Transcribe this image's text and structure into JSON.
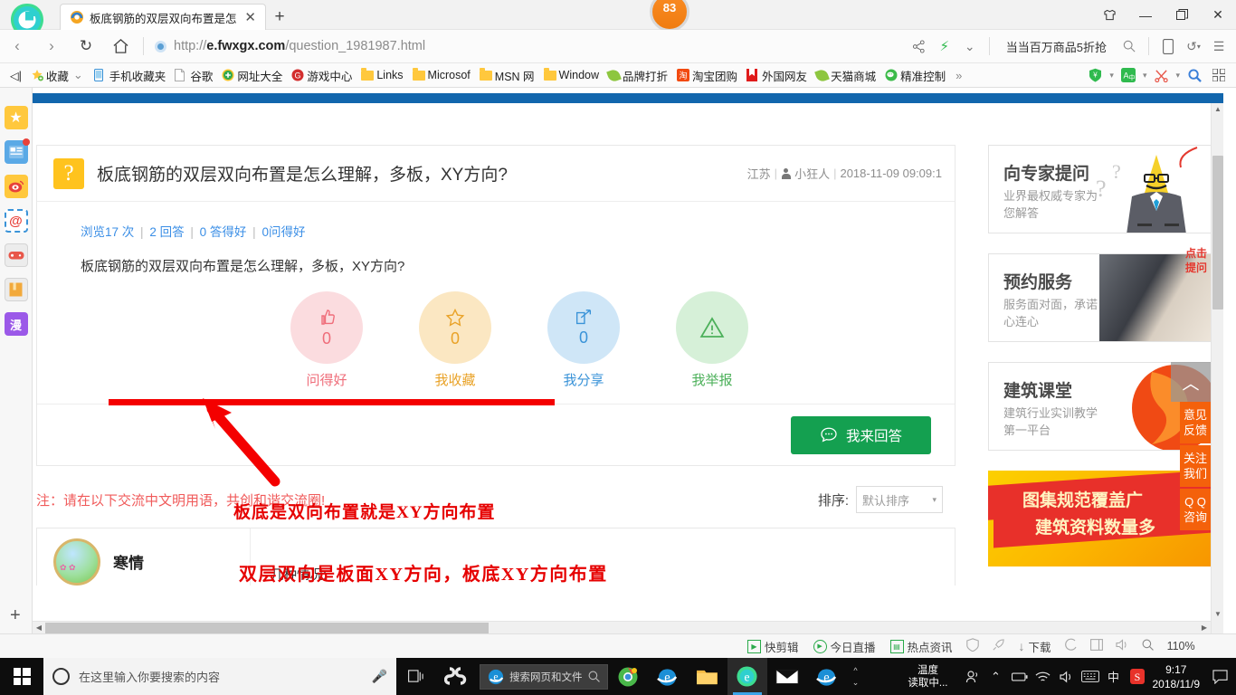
{
  "browser": {
    "tab": {
      "title": "板底钢筋的双层双向布置是怎么理",
      "close": "✕",
      "favicon": "browser-favicon"
    },
    "newtab_label": "+",
    "badge": "83",
    "window_controls": {
      "shirt": "👕",
      "minimize": "—",
      "restore": "❐",
      "close": "✕"
    },
    "nav": {
      "back": "‹",
      "forward": "›",
      "reload": "↻",
      "home": "⌂"
    },
    "url": {
      "scheme": "http://",
      "domain": "e.fwxgx.com",
      "path": "/question_1981987.html"
    },
    "promo": "当当百万商品5折抢",
    "nav_right_icons": [
      "share-icon",
      "lightning-icon",
      "chevron-down-icon",
      "search-icon",
      "mobile-icon",
      "undo-icon",
      "menu-icon"
    ],
    "bookmarks": [
      {
        "label": "收藏",
        "icon": "star-bookmark-icon",
        "has_chevron": true
      },
      {
        "label": "手机收藏夹",
        "icon": "mobile-icon"
      },
      {
        "label": "谷歌",
        "icon": "page-icon"
      },
      {
        "label": "网址大全",
        "icon": "plus-green-icon"
      },
      {
        "label": "游戏中心",
        "icon": "game-red-icon"
      },
      {
        "label": "Links",
        "icon": "folder-icon"
      },
      {
        "label": "Microsof",
        "icon": "folder-icon"
      },
      {
        "label": "MSN 网",
        "icon": "folder-icon"
      },
      {
        "label": "Window",
        "icon": "folder-icon"
      },
      {
        "label": "品牌打折",
        "icon": "leaf-icon"
      },
      {
        "label": "淘宝团购",
        "icon": "taobao-icon"
      },
      {
        "label": "外国网友",
        "icon": "red-flag-icon"
      },
      {
        "label": "天猫商城",
        "icon": "leaf-icon"
      },
      {
        "label": "精准控制",
        "icon": "wechat-icon"
      }
    ],
    "bookmarks_overflow": "»",
    "bookmarks_right_icons": [
      "shield-icon",
      "translate-icon",
      "scissors-icon",
      "magnifier-icon",
      "apps-icon"
    ],
    "back_arrow": "◁|"
  },
  "leftbar": {
    "items": [
      {
        "name": "favorites-star",
        "glyph": "★",
        "bg": "#ffc83d",
        "fg": "#ffffff"
      },
      {
        "name": "news-feed",
        "glyph": "▤",
        "bg": "#5aa9e6",
        "fg": "#ffffff",
        "dot": true
      },
      {
        "name": "weibo",
        "glyph": "◉",
        "bg": "#ffc83d",
        "fg": "#e8413a"
      },
      {
        "name": "email-at",
        "glyph": "@",
        "bg": "#ffffff",
        "fg": "#e8413a"
      },
      {
        "name": "game-pad",
        "glyph": "🎮",
        "bg": "#eeeeee",
        "fg": "#e8413a"
      },
      {
        "name": "book",
        "glyph": "📙",
        "bg": "#eeeeee",
        "fg": "#f0a020"
      },
      {
        "name": "comic",
        "glyph": "漫",
        "bg": "#9b59e8",
        "fg": "#ffffff"
      }
    ],
    "add": "+"
  },
  "question": {
    "mark": "?",
    "title": "板底钢筋的双层双向布置是怎么理解，多板，XY方向?",
    "meta": {
      "region": "江苏",
      "author": "小狂人",
      "time": "2018-11-09 09:09:1"
    },
    "stats": {
      "views": "浏览17 次",
      "answers": "2 回答",
      "good_answers": "0 答得好",
      "good_questions": "0问得好"
    },
    "body": "板底钢筋的双层双向布置是怎么理解，多板，XY方向?",
    "actions": [
      {
        "name": "praise",
        "icon": "thumbs-up-icon",
        "count": "0",
        "label": "问得好",
        "bg": "#fbdcdf",
        "fg": "#ef6d7a"
      },
      {
        "name": "favorite",
        "icon": "star-icon",
        "count": "0",
        "label": "我收藏",
        "bg": "#fbe7c2",
        "fg": "#e9a227"
      },
      {
        "name": "share",
        "icon": "share-icon",
        "count": "0",
        "label": "我分享",
        "bg": "#cfe6f7",
        "fg": "#3a93d8"
      },
      {
        "name": "report",
        "icon": "warning-icon",
        "count": "",
        "label": "我举报",
        "bg": "#d6f0d8",
        "fg": "#4cb05a"
      }
    ],
    "answer_button": {
      "label": "我来回答",
      "icon": "comment-icon",
      "color": "#14a050"
    }
  },
  "annotations": {
    "text1": "板底是双向布置就是XY方向布置",
    "text2": "双层双向是板面XY方向，板底XY方向布置",
    "color": "#e60000"
  },
  "notice": "注：请在以下交流中文明用语，共创和谐交流圈!",
  "sort": {
    "label": "排序:",
    "value": "默认排序",
    "caret": "▾"
  },
  "answers": [
    {
      "author": "寒情",
      "text": "几种情况:"
    }
  ],
  "sidebar_ads": [
    {
      "name": "ask-expert",
      "title": "向专家提问",
      "subtitle": "业界最权威专家为您解答",
      "bubble": "点击\n提问"
    },
    {
      "name": "appointment-service",
      "title": "预约服务",
      "subtitle": "服务面对面，承诺心连心"
    },
    {
      "name": "construction-class",
      "title": "建筑课堂",
      "subtitle": "建筑行业实训教学第一平台"
    }
  ],
  "big_ad": {
    "line1": "图集规范覆盖广",
    "line2": "建筑资料数量多"
  },
  "float_buttons": [
    {
      "name": "scroll-top",
      "label": "︿"
    },
    {
      "name": "feedback",
      "label": "意见\n反馈"
    },
    {
      "name": "follow-us",
      "label": "关注\n我们"
    },
    {
      "name": "qq-consult",
      "label": "Q Q\n咨询"
    }
  ],
  "statusbar": {
    "items": [
      {
        "label": "快剪辑",
        "icon": "clip-icon"
      },
      {
        "label": "今日直播",
        "icon": "live-icon"
      },
      {
        "label": "热点资讯",
        "icon": "news-icon"
      },
      {
        "label": "",
        "icon": "shield-gray-icon"
      },
      {
        "label": "",
        "icon": "rocket-icon"
      },
      {
        "label": "下载",
        "icon": "download-icon"
      },
      {
        "label": "",
        "icon": "compass-icon"
      },
      {
        "label": "",
        "icon": "window-icon"
      },
      {
        "label": "",
        "icon": "sound-icon"
      },
      {
        "label": "",
        "icon": "search-icon"
      }
    ],
    "zoom": "110%"
  },
  "taskbar": {
    "search_placeholder": "在这里输入你要搜索的内容",
    "mic": "microphone-icon",
    "taskview": "task-view-icon",
    "apps": [
      {
        "name": "cortana-swirl-icon"
      },
      {
        "name": "ie-search-box",
        "label": "搜索网页和文件"
      },
      {
        "name": "chrome-icon"
      },
      {
        "name": "edge-icon"
      },
      {
        "name": "ie-icon"
      },
      {
        "name": "explorer-icon"
      },
      {
        "name": "browser-360-icon",
        "active": true
      },
      {
        "name": "mail-icon"
      },
      {
        "name": "edge2-icon"
      }
    ],
    "tray": {
      "temp_label": "温度",
      "temp_value": "读取中...",
      "time": "9:17",
      "date": "2018/11/9"
    },
    "tray_icons": [
      "people-icon",
      "chevron-up-icon",
      "battery-icon",
      "wifi-icon",
      "volume-icon",
      "keyboard-icon",
      "ime-cn-icon",
      "sogou-icon"
    ]
  }
}
